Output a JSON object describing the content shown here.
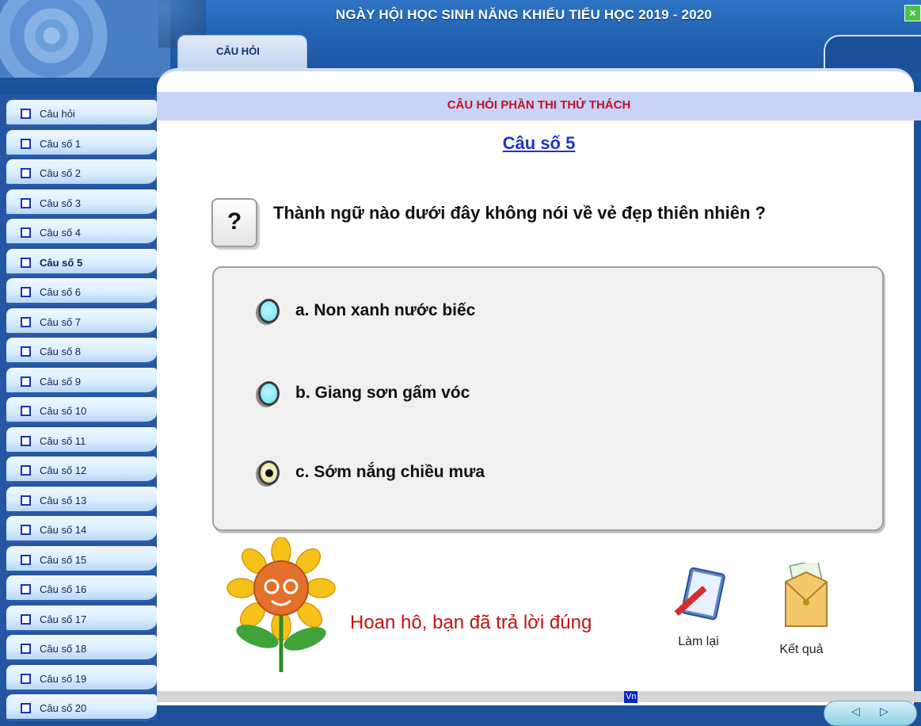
{
  "header": {
    "title": "NGÀY HỘI HỌC SINH NĂNG KHIẾU TIỂU HỌC 2019 - 2020",
    "close_glyph": "×",
    "tab_label": "CÂU HỎI"
  },
  "banner": {
    "title": "CÂU HỎI PHẦN THI THỬ THÁCH"
  },
  "question": {
    "number_label": "Câu số 5",
    "icon_glyph": "?",
    "text": "Thành ngữ nào dưới đây không nói về vẻ đẹp thiên nhiên ?",
    "options": [
      {
        "label": "a. Non xanh nước biếc",
        "selected": false
      },
      {
        "label": "b. Giang sơn gấm vóc",
        "selected": false
      },
      {
        "label": "c. Sớm nắng chiều mưa",
        "selected": true
      }
    ]
  },
  "sidebar": {
    "active_index": 5,
    "items": [
      "Câu hỏi",
      "Câu số 1",
      "Câu số 2",
      "Câu số 3",
      "Câu số 4",
      "Câu số 5",
      "Câu số 6",
      "Câu số 7",
      "Câu số 8",
      "Câu số 9",
      "Câu số 10",
      "Câu số 11",
      "Câu số 12",
      "Câu số 13",
      "Câu số 14",
      "Câu số 15",
      "Câu số 16",
      "Câu số 17",
      "Câu số 18",
      "Câu số 19",
      "Câu số 20"
    ]
  },
  "feedback": {
    "message": "Hoan hô, bạn đã trả lời đúng"
  },
  "actions": {
    "retry_label": "Làm lại",
    "result_label": "Kết quả"
  },
  "status": {
    "input_method": "Vn"
  },
  "colors": {
    "title_red": "#c1121f",
    "question_blue": "#1f33c7",
    "feedback_red": "#c01313"
  }
}
